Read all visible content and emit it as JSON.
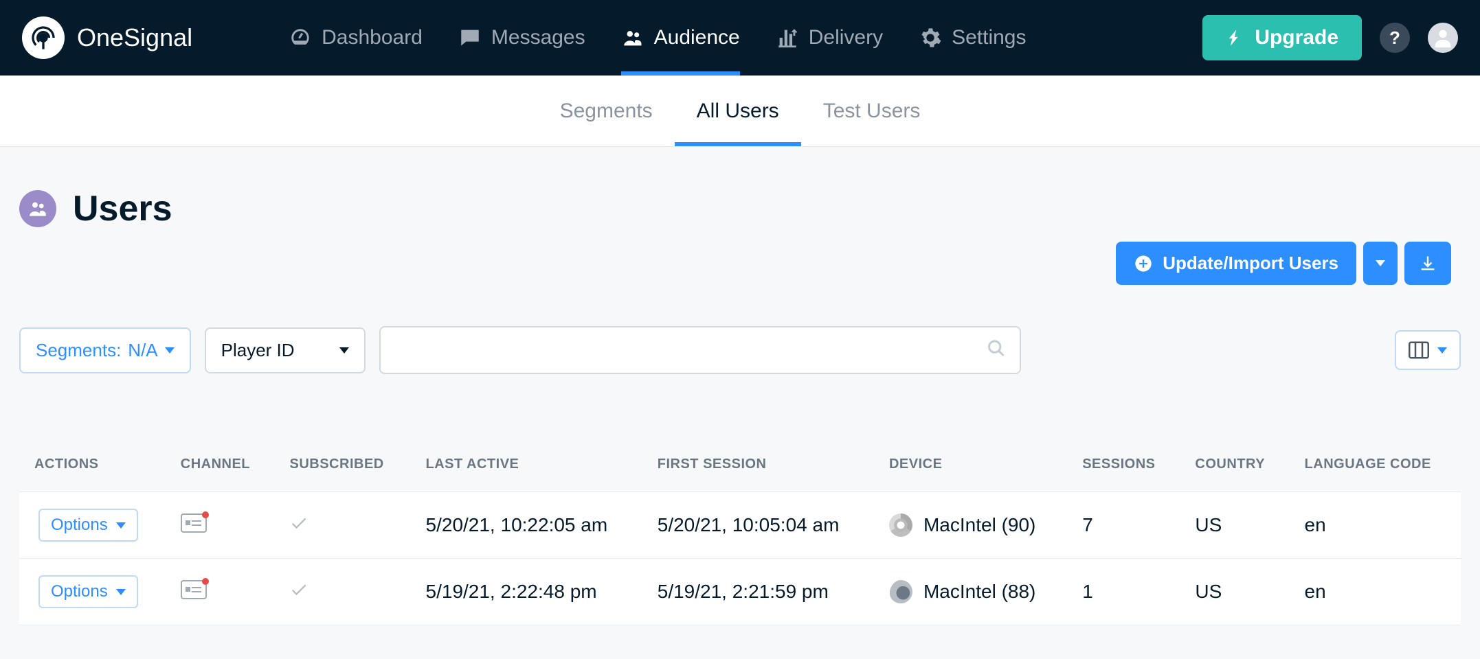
{
  "brand": {
    "name": "OneSignal"
  },
  "nav": {
    "items": [
      {
        "label": "Dashboard",
        "icon": "dashboard-icon",
        "active": false
      },
      {
        "label": "Messages",
        "icon": "messages-icon",
        "active": false
      },
      {
        "label": "Audience",
        "icon": "audience-icon",
        "active": true
      },
      {
        "label": "Delivery",
        "icon": "delivery-icon",
        "active": false
      },
      {
        "label": "Settings",
        "icon": "settings-icon",
        "active": false
      }
    ],
    "upgrade_label": "Upgrade"
  },
  "subnav": {
    "items": [
      {
        "label": "Segments",
        "active": false
      },
      {
        "label": "All Users",
        "active": true
      },
      {
        "label": "Test Users",
        "active": false
      }
    ]
  },
  "page": {
    "title": "Users"
  },
  "actions": {
    "update_import_label": "Update/Import Users"
  },
  "filters": {
    "segments_label_prefix": "Segments:  ",
    "segments_value": "N/A",
    "search_by_selected": "Player ID",
    "search_value": "",
    "search_placeholder": ""
  },
  "table": {
    "columns": [
      "ACTIONS",
      "CHANNEL",
      "SUBSCRIBED",
      "LAST ACTIVE",
      "FIRST SESSION",
      "DEVICE",
      "SESSIONS",
      "COUNTRY",
      "LANGUAGE CODE"
    ],
    "options_label": "Options",
    "rows": [
      {
        "last_active": "5/20/21, 10:22:05 am",
        "first_session": "5/20/21, 10:05:04 am",
        "device": "MacIntel (90)",
        "browser": "chrome",
        "sessions": "7",
        "country": "US",
        "language_code": "en"
      },
      {
        "last_active": "5/19/21, 2:22:48 pm",
        "first_session": "5/19/21, 2:21:59 pm",
        "device": "MacIntel (88)",
        "browser": "firefox",
        "sessions": "1",
        "country": "US",
        "language_code": "en"
      }
    ]
  }
}
